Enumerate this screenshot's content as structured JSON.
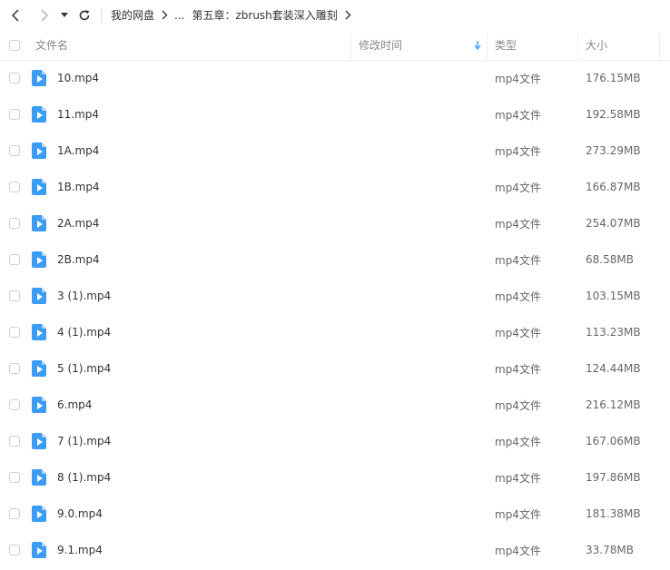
{
  "breadcrumb": {
    "root": "我的网盘",
    "ellipsis": "...",
    "current": "第五章：zbrush套装深入雕刻"
  },
  "columns": {
    "name": "文件名",
    "modified": "修改时间",
    "type": "类型",
    "size": "大小"
  },
  "files": [
    {
      "name": "10.mp4",
      "type": "mp4文件",
      "size": "176.15MB"
    },
    {
      "name": "11.mp4",
      "type": "mp4文件",
      "size": "192.58MB"
    },
    {
      "name": "1A.mp4",
      "type": "mp4文件",
      "size": "273.29MB"
    },
    {
      "name": "1B.mp4",
      "type": "mp4文件",
      "size": "166.87MB"
    },
    {
      "name": "2A.mp4",
      "type": "mp4文件",
      "size": "254.07MB"
    },
    {
      "name": "2B.mp4",
      "type": "mp4文件",
      "size": "68.58MB"
    },
    {
      "name": "3 (1).mp4",
      "type": "mp4文件",
      "size": "103.15MB"
    },
    {
      "name": "4 (1).mp4",
      "type": "mp4文件",
      "size": "113.23MB"
    },
    {
      "name": "5 (1).mp4",
      "type": "mp4文件",
      "size": "124.44MB"
    },
    {
      "name": "6.mp4",
      "type": "mp4文件",
      "size": "216.12MB"
    },
    {
      "name": "7 (1).mp4",
      "type": "mp4文件",
      "size": "167.06MB"
    },
    {
      "name": "8 (1).mp4",
      "type": "mp4文件",
      "size": "197.86MB"
    },
    {
      "name": "9.0.mp4",
      "type": "mp4文件",
      "size": "181.38MB"
    },
    {
      "name": "9.1.mp4",
      "type": "mp4文件",
      "size": "33.78MB"
    }
  ],
  "icons": {
    "video_file": "video-file-icon",
    "back": "chevron-left-icon",
    "forward": "chevron-right-icon",
    "dropdown": "caret-down-icon",
    "refresh": "refresh-icon",
    "sort": "sort-arrow-down-icon"
  },
  "colors": {
    "accent": "#3b9cf5",
    "text": "#333333",
    "muted": "#666666"
  }
}
